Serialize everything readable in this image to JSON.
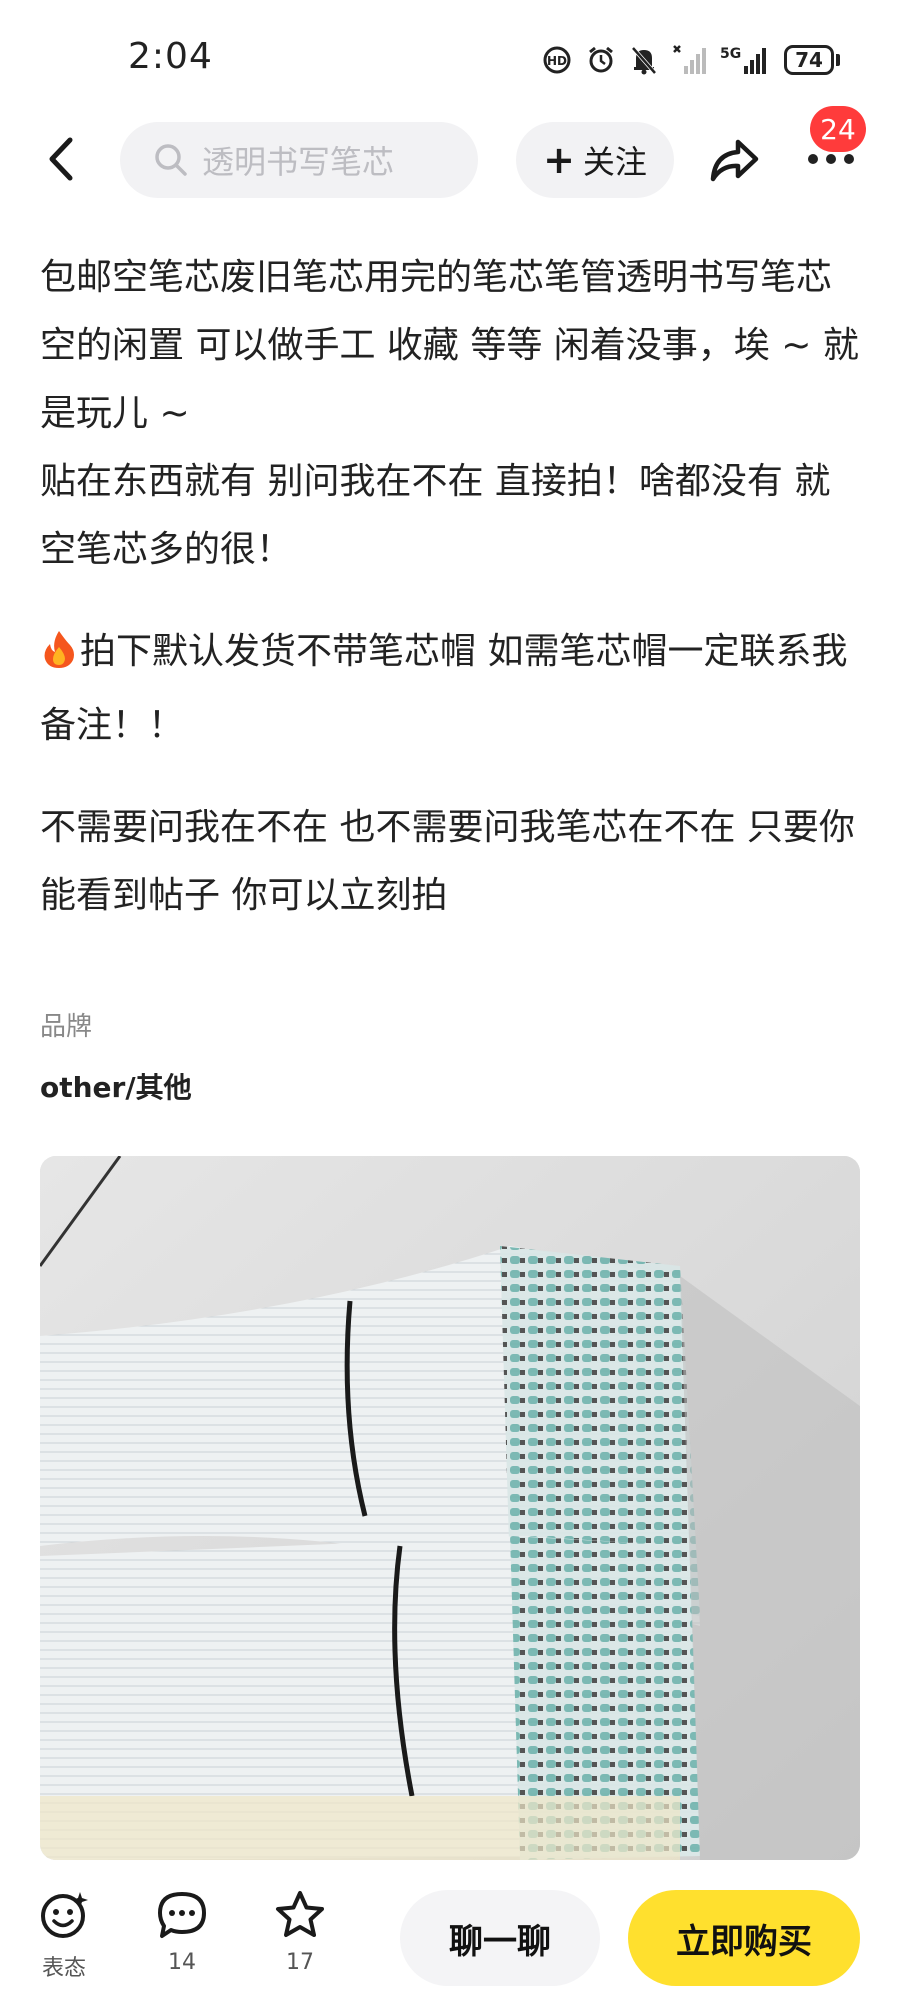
{
  "status_bar": {
    "time": "2:04",
    "network": "5G",
    "battery": "74",
    "icons": [
      "hd-icon",
      "alarm-icon",
      "mute-icon",
      "signal-icon",
      "network-icon",
      "battery-icon"
    ]
  },
  "nav": {
    "search_placeholder": "透明书写笔芯",
    "follow_label": "关注",
    "notification_count": "24",
    "icons": [
      "back-icon",
      "search-icon",
      "share-icon",
      "more-icon"
    ]
  },
  "description": {
    "paragraphs": [
      "包邮空笔芯废旧笔芯用完的笔芯笔管透明书写笔芯空的闲置 可以做手工 收藏 等等 闲着没事，埃 ~ 就是玩儿 ~",
      "贴在东西就有 别问我在不在 直接拍！啥都没有 就空笔芯多的很！",
      "拍下默认发货不带笔芯帽 如需笔芯帽一定联系我备注！！",
      "不需要问我在不在 也不需要问我笔芯在不在 只要你能看到帖子  你可以立刻拍"
    ]
  },
  "brand": {
    "label": "品牌",
    "value": "other/其他"
  },
  "bottom_bar": {
    "react_label": "表态",
    "comment_count": "14",
    "favorite_count": "17",
    "chat_label": "聊一聊",
    "buy_label": "立即购买"
  },
  "colors": {
    "buy_button": "#ffe02e",
    "badge": "#ff3b3b",
    "chip_background": "#f2f2f4"
  }
}
